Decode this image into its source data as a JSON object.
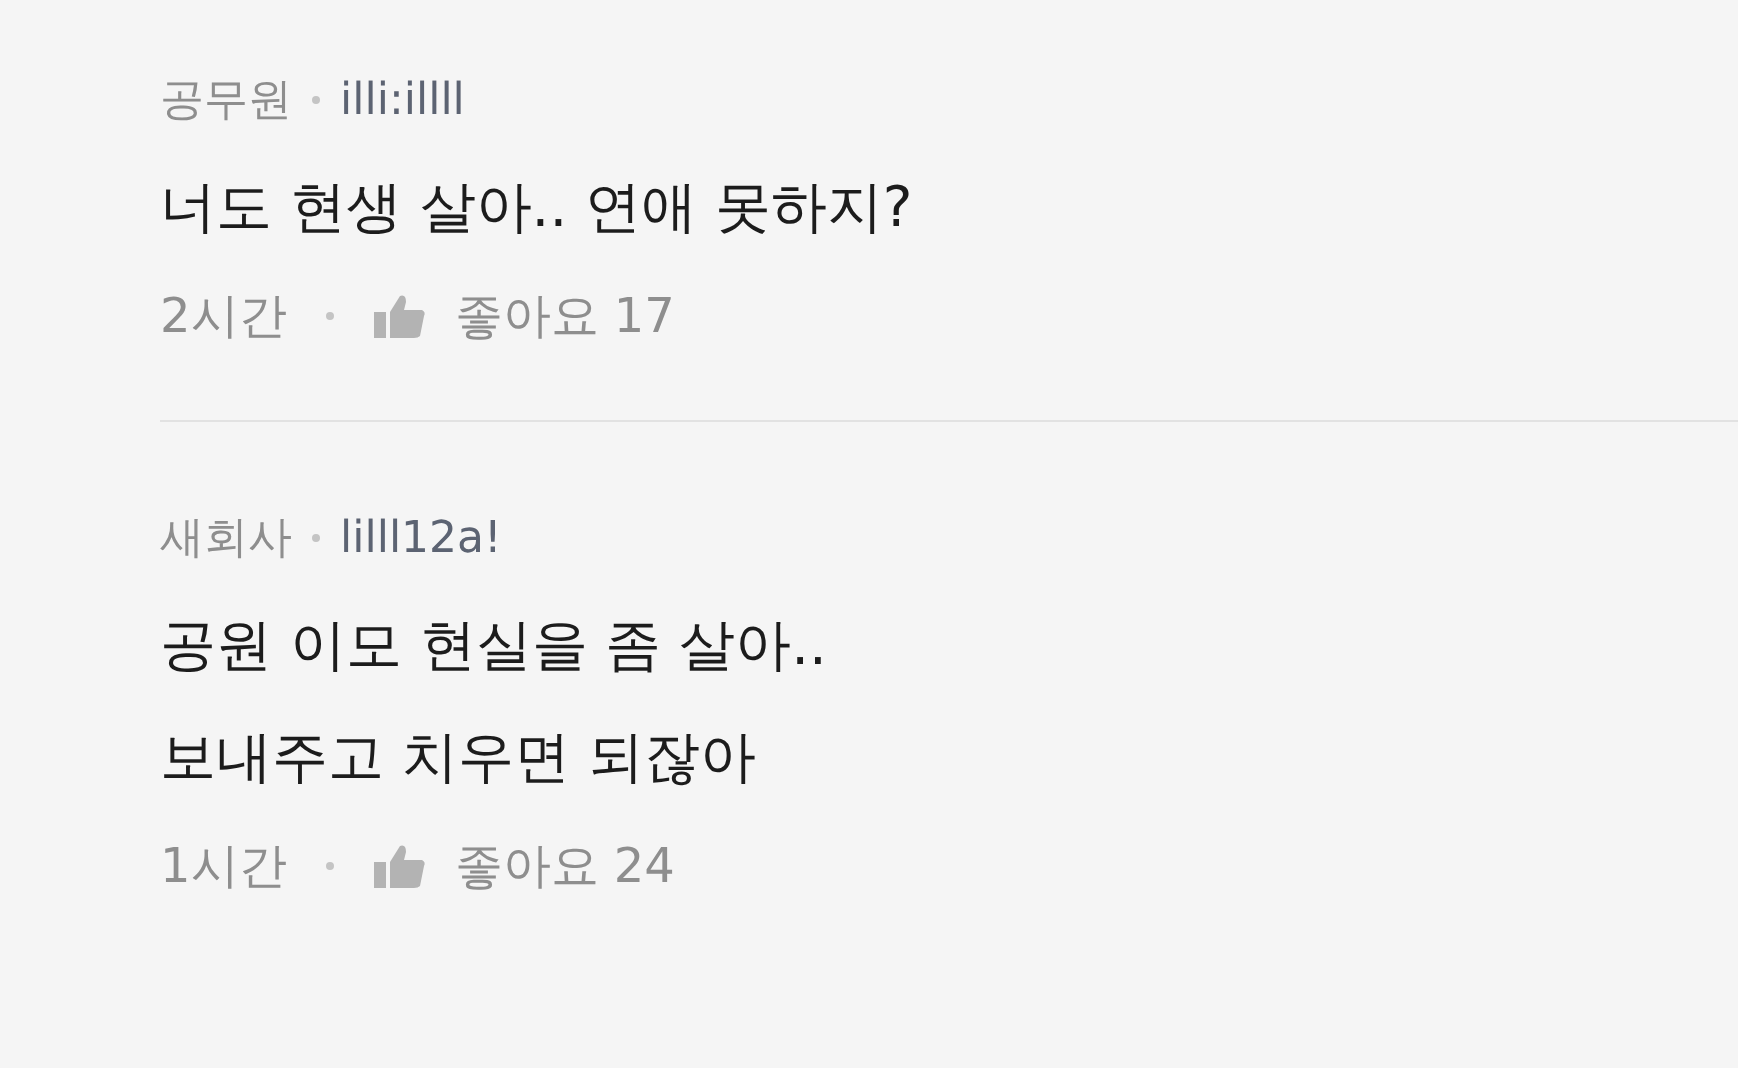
{
  "comments": [
    {
      "author": "공무원",
      "user_id": "illi:illll",
      "text": "너도 현생 살아.. 연애 못하지?",
      "time": "2시간",
      "likes_label": "좋아요 17"
    },
    {
      "author": "새회사",
      "user_id": "lilll12a!",
      "text": "공원 이모 현실을 좀 살아..\n보내주고 치우면 되잖아",
      "time": "1시간",
      "likes_label": "좋아요 24"
    }
  ]
}
